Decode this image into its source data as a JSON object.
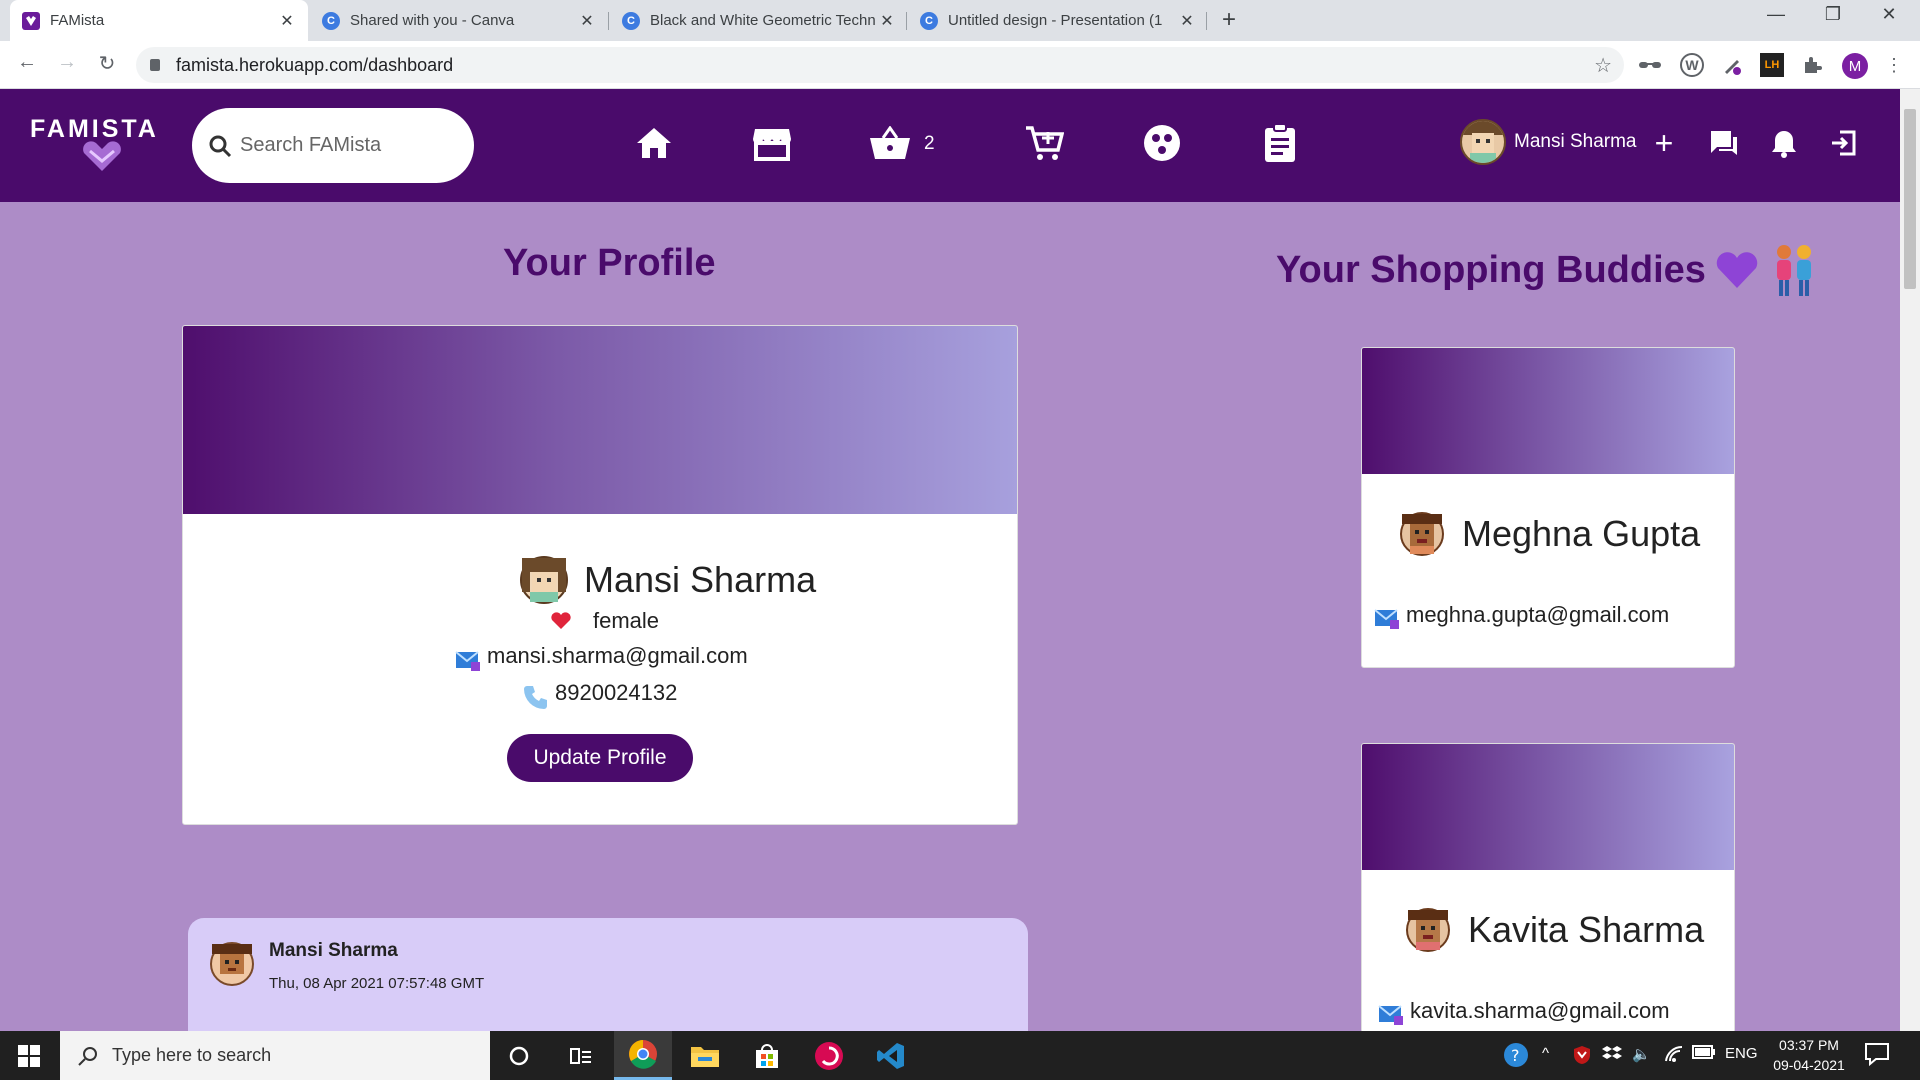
{
  "browser": {
    "tabs": [
      {
        "title": "FAMista",
        "favicon_color": "#6a1b9a"
      },
      {
        "title": "Shared with you - Canva",
        "favicon_color": "#3d7be0"
      },
      {
        "title": "Black and White Geometric Techn",
        "favicon_color": "#3d7be0"
      },
      {
        "title": "Untitled design - Presentation (1",
        "favicon_color": "#3d7be0"
      }
    ],
    "favicon_letter": "C",
    "url": "famista.herokuapp.com/dashboard",
    "profile_initial": "M",
    "ext_wp": "W",
    "ext_lh": "LH"
  },
  "app": {
    "logo": "FAMISTA",
    "search_placeholder": "Search FAMista",
    "cart_count": "2",
    "user_name": "Mansi Sharma",
    "accent": "#4a0b6b",
    "background": "#ad8cc7"
  },
  "profile": {
    "heading": "Your Profile",
    "name": "Mansi Sharma",
    "gender": "female",
    "email": "mansi.sharma@gmail.com",
    "phone": "8920024132",
    "update_label": "Update Profile"
  },
  "buddies": {
    "heading": "Your Shopping Buddies",
    "items": [
      {
        "name": "Meghna Gupta",
        "email": "meghna.gupta@gmail.com"
      },
      {
        "name": "Kavita Sharma",
        "email": "kavita.sharma@gmail.com"
      }
    ]
  },
  "post": {
    "author": "Mansi Sharma",
    "timestamp": "Thu, 08 Apr 2021 07:57:48 GMT"
  },
  "taskbar": {
    "search_placeholder": "Type here to search",
    "lang": "ENG",
    "time": "03:37 PM",
    "date": "09-04-2021"
  }
}
